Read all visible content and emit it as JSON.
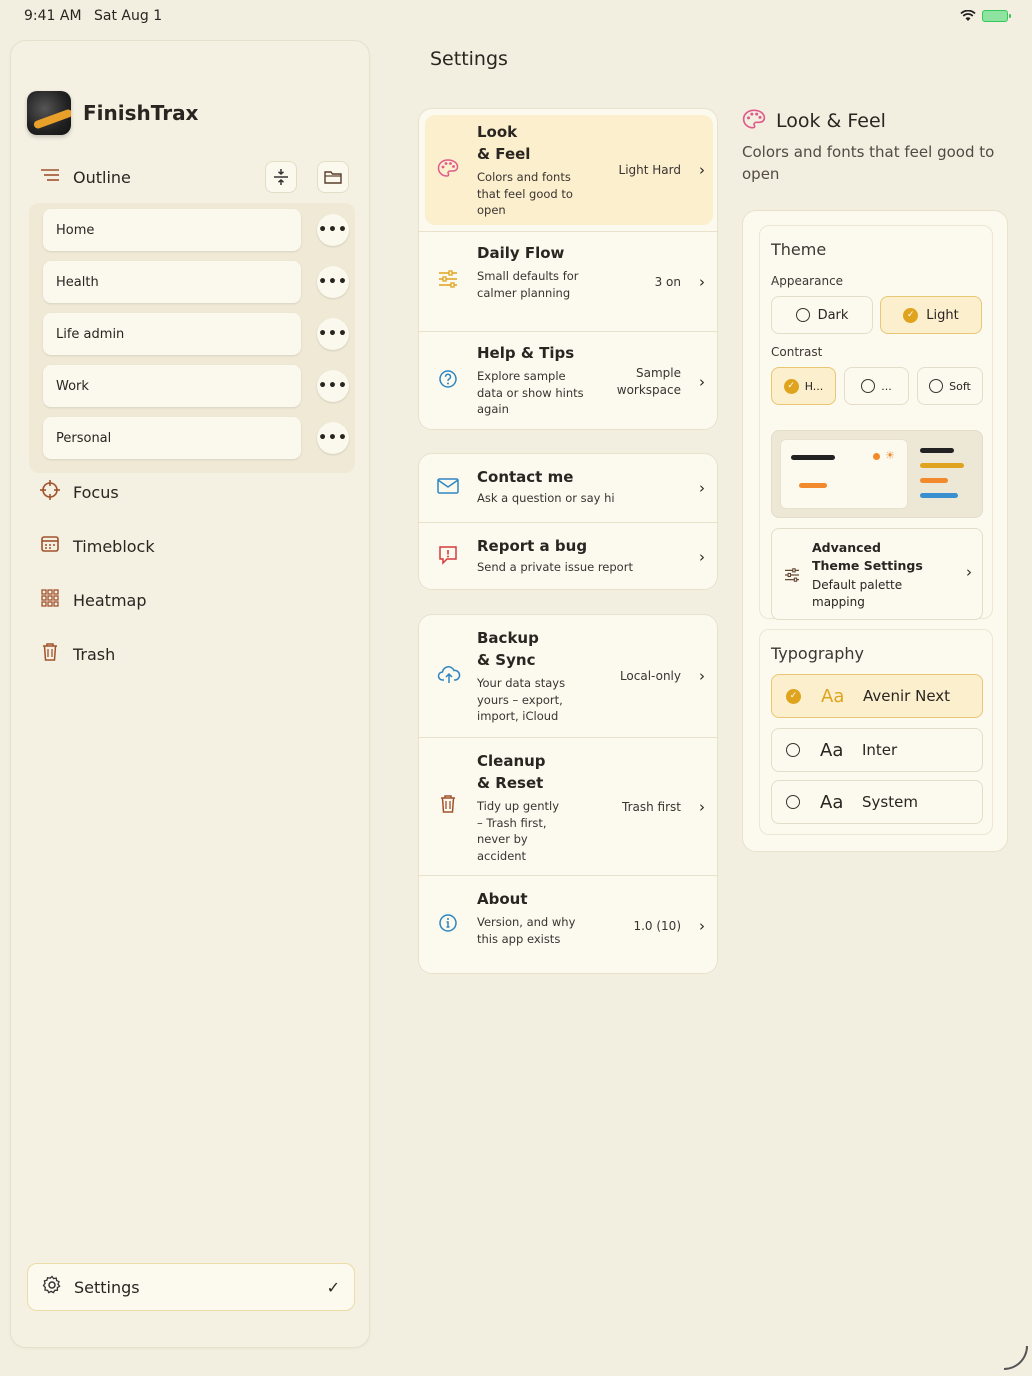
{
  "status": {
    "time": "9:41 AM",
    "date": "Sat Aug 1"
  },
  "sidebar": {
    "app_title": "FinishTrax",
    "outline_label": "Outline",
    "outline_items": [
      {
        "label": "Home"
      },
      {
        "label": "Health"
      },
      {
        "label": "Life admin"
      },
      {
        "label": "Work"
      },
      {
        "label": "Personal"
      }
    ],
    "nav": [
      {
        "label": "Focus"
      },
      {
        "label": "Timeblock"
      },
      {
        "label": "Heatmap"
      },
      {
        "label": "Trash"
      }
    ],
    "settings_label": "Settings",
    "settings_check": "✓"
  },
  "main": {
    "title": "Settings",
    "groups": [
      {
        "rows": [
          {
            "title_line1": "Look",
            "title_line2": "& Feel",
            "subtitle": "Colors and fonts that feel good to open",
            "value": "Light Hard"
          },
          {
            "title_line1": "Daily Flow",
            "subtitle": "Small defaults for calmer planning",
            "value": "3 on"
          },
          {
            "title_line1": "Help & Tips",
            "subtitle": "Explore sample data or show hints again",
            "value_line1": "Sample",
            "value_line2": "workspace"
          }
        ]
      },
      {
        "rows": [
          {
            "title_line1": "Contact me",
            "subtitle": "Ask a question or say hi"
          },
          {
            "title_line1": "Report a bug",
            "subtitle": "Send a private issue report"
          }
        ]
      },
      {
        "rows": [
          {
            "title_line1": "Backup",
            "title_line2": "& Sync",
            "subtitle": "Your data stays yours – export, import, iCloud",
            "value": "Local-only"
          },
          {
            "title_line1": "Cleanup",
            "title_line2": "& Reset",
            "subtitle": "Tidy up gently – Trash first, never by accident",
            "value": "Trash first"
          },
          {
            "title_line1": "About",
            "subtitle": "Version, and why this app exists",
            "value": "1.0 (10)"
          }
        ]
      }
    ]
  },
  "detail": {
    "title": "Look & Feel",
    "subtitle": "Colors and fonts that feel good to open",
    "theme": {
      "title": "Theme",
      "appearance_label": "Appearance",
      "appearance_options": [
        "Dark",
        "Light"
      ],
      "appearance_selected": "Light",
      "contrast_label": "Contrast",
      "contrast_options": [
        "H...",
        "...",
        "Soft"
      ],
      "contrast_selected": "H...",
      "advanced_title_line1": "Advanced",
      "advanced_title_line2": "Theme Settings",
      "advanced_subtitle_line1": "Default palette",
      "advanced_subtitle_line2": "mapping"
    },
    "typography": {
      "title": "Typography",
      "sample": "Aa",
      "options": [
        "Avenir Next",
        "Inter",
        "System"
      ],
      "selected": "Avenir Next"
    }
  },
  "colors": {
    "background": "#f3efe0",
    "accent": "#e0a31e",
    "selected_bg": "#fbefcd",
    "icon_brown": "#a0522d",
    "icon_blue": "#2e86c1",
    "icon_pink": "#e05a8a",
    "icon_red": "#d63b3b",
    "preview_orange": "#f08a2c",
    "preview_blue": "#3a8fd1"
  }
}
